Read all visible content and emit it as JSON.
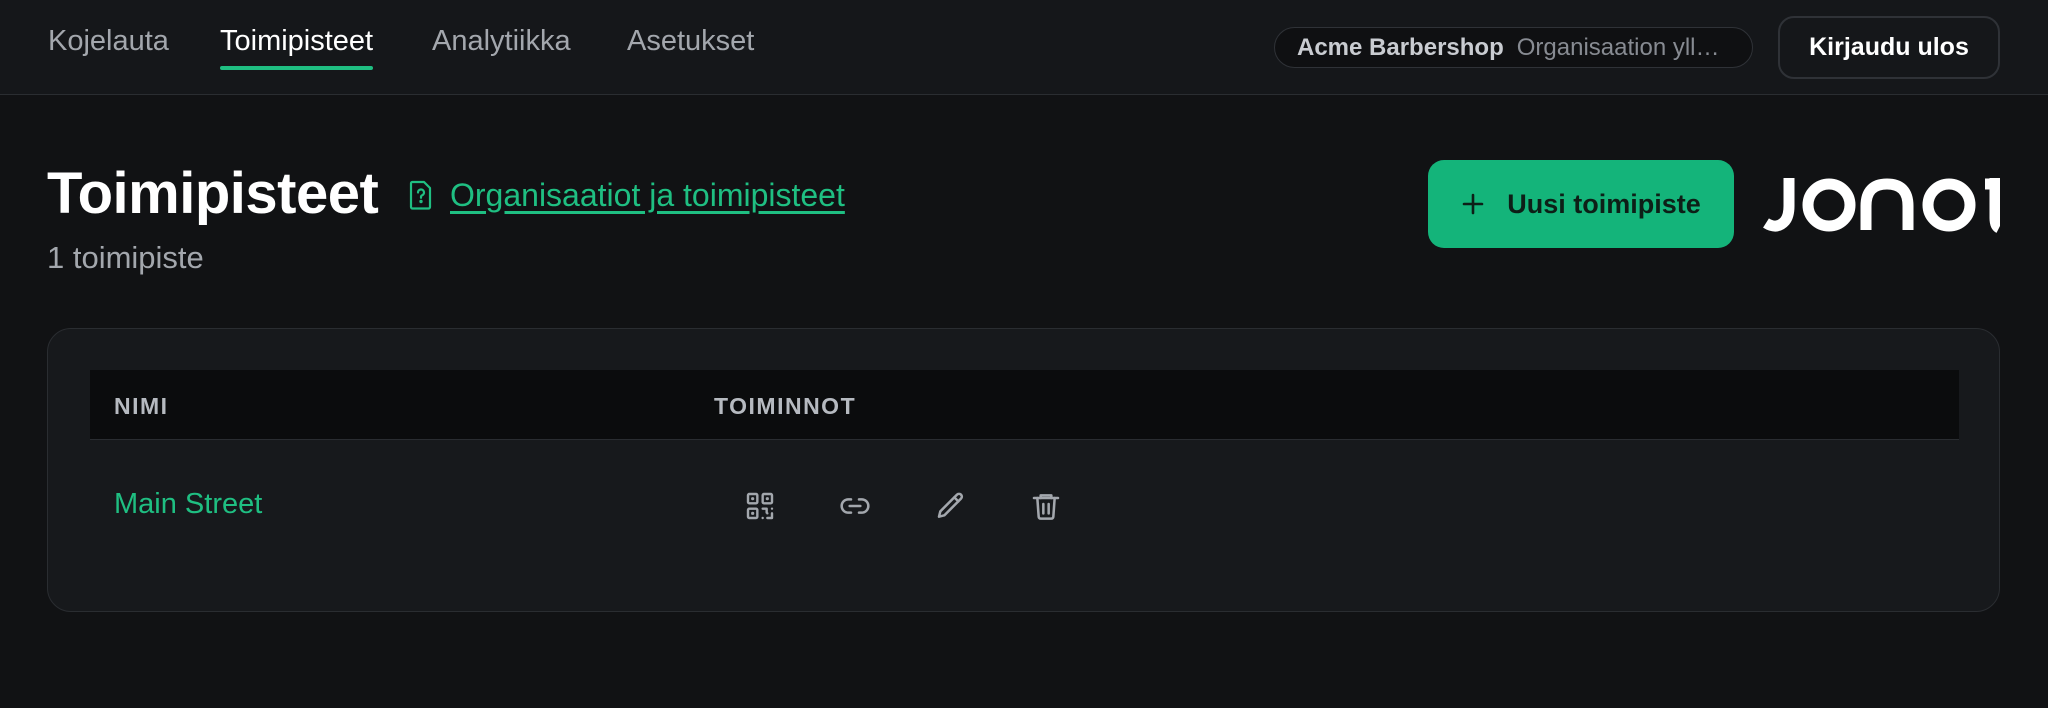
{
  "nav": {
    "tabs": [
      {
        "label": "Kojelauta"
      },
      {
        "label": "Toimipisteet"
      },
      {
        "label": "Analytiikka"
      },
      {
        "label": "Asetukset"
      }
    ],
    "active_tab": "Toimipisteet",
    "org_name": "Acme Barbershop",
    "org_role": "Organisaation ylläpitäjä",
    "logout_label": "Kirjaudu ulos"
  },
  "header": {
    "title": "Toimipisteet",
    "doc_link": "Organisaatiot ja toimipisteet",
    "subtitle": "1 toimipiste",
    "new_button": "Uusi toimipiste",
    "brand": "jonot"
  },
  "table": {
    "columns": [
      "NIMI",
      "TOIMINNOT"
    ],
    "rows": [
      {
        "name": "Main Street",
        "actions": [
          "qr-code-icon",
          "link-icon",
          "edit-icon",
          "delete-icon"
        ]
      }
    ]
  },
  "colors": {
    "accent": "#1fbf82",
    "button_bg": "#14b47a",
    "background": "#111214",
    "card": "#17191c"
  }
}
